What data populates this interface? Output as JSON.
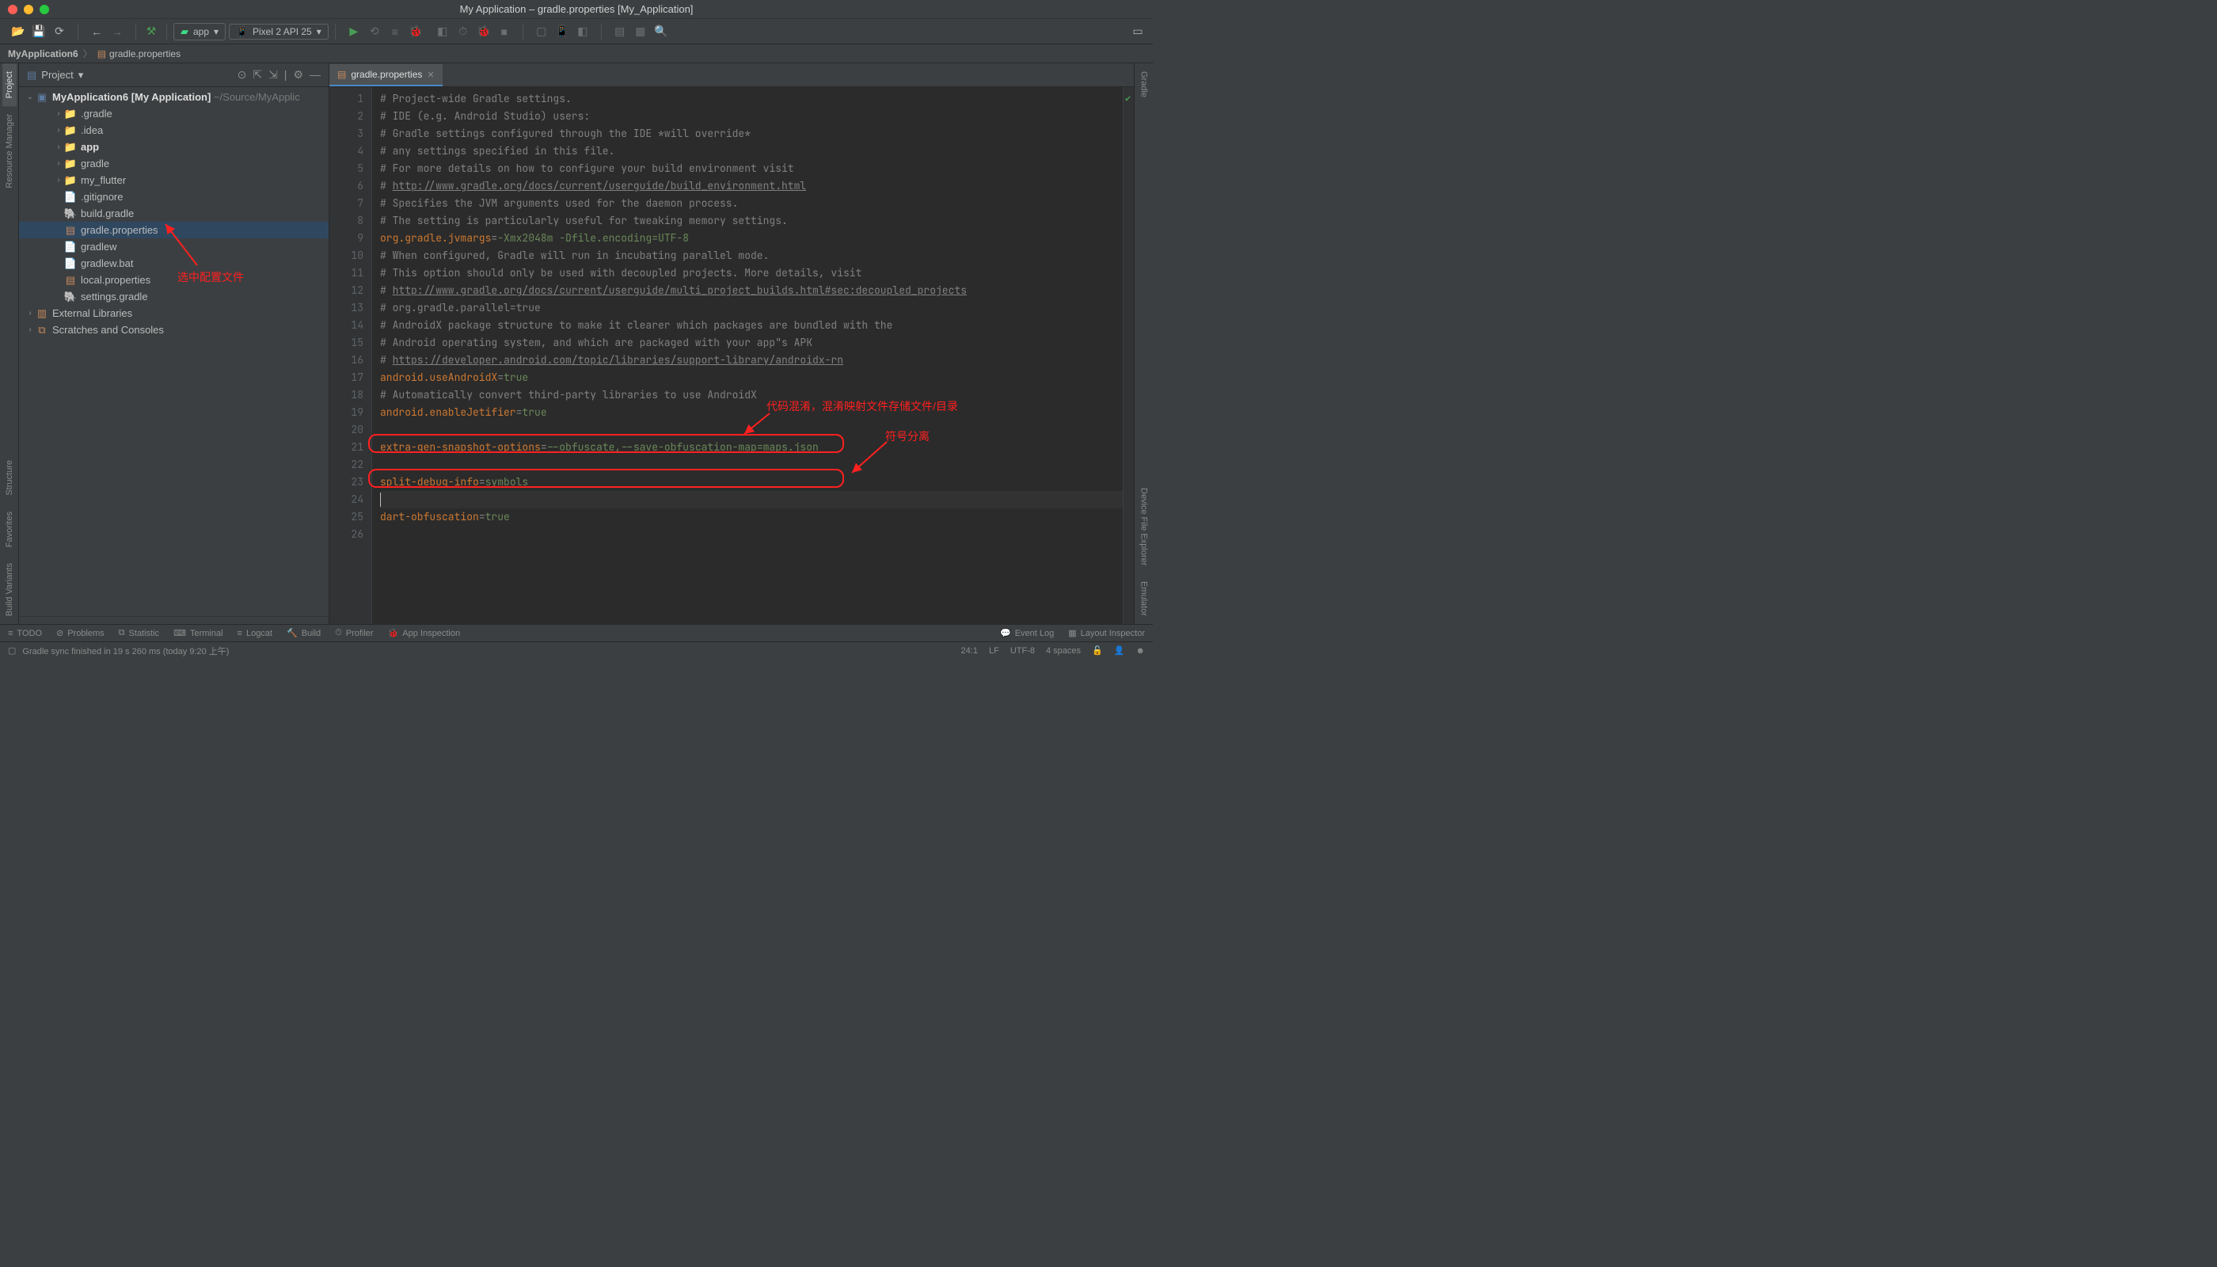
{
  "window": {
    "title": "My Application – gradle.properties [My_Application]"
  },
  "toolbar": {
    "config_app": "app",
    "device": "Pixel 2 API 25"
  },
  "breadcrumb": {
    "root": "MyApplication6",
    "file": "gradle.properties"
  },
  "projectPanel": {
    "title": "Project",
    "tree": {
      "root": {
        "name": "MyApplication6",
        "suffix": " [My Application]",
        "path": "~/Source/MyApplic"
      },
      "items": [
        {
          "name": ".gradle",
          "icon": "folder-orange",
          "indent": 1,
          "arrow": "›"
        },
        {
          "name": ".idea",
          "icon": "folder-grey",
          "indent": 1,
          "arrow": "›"
        },
        {
          "name": "app",
          "icon": "folder-blue",
          "indent": 1,
          "arrow": "›",
          "bold": true
        },
        {
          "name": "gradle",
          "icon": "folder-grey",
          "indent": 1,
          "arrow": "›"
        },
        {
          "name": "my_flutter",
          "icon": "folder-grey",
          "indent": 1,
          "arrow": "›"
        },
        {
          "name": ".gitignore",
          "icon": "file",
          "indent": 1
        },
        {
          "name": "build.gradle",
          "icon": "gradle",
          "indent": 1
        },
        {
          "name": "gradle.properties",
          "icon": "props",
          "indent": 1,
          "selected": true
        },
        {
          "name": "gradlew",
          "icon": "file-purple",
          "indent": 1
        },
        {
          "name": "gradlew.bat",
          "icon": "file",
          "indent": 1
        },
        {
          "name": "local.properties",
          "icon": "props",
          "indent": 1
        },
        {
          "name": "settings.gradle",
          "icon": "gradle",
          "indent": 1
        }
      ],
      "externals": "External Libraries",
      "scratches": "Scratches and Consoles"
    }
  },
  "editor": {
    "tab_label": "gradle.properties",
    "lines": [
      {
        "n": 1,
        "t": "comment",
        "text": "# Project-wide Gradle settings."
      },
      {
        "n": 2,
        "t": "comment",
        "text": "# IDE (e.g. Android Studio) users:"
      },
      {
        "n": 3,
        "t": "comment",
        "text": "# Gradle settings configured through the IDE *will override*"
      },
      {
        "n": 4,
        "t": "comment",
        "text": "# any settings specified in this file."
      },
      {
        "n": 5,
        "t": "comment",
        "text": "# For more details on how to configure your build environment visit"
      },
      {
        "n": 6,
        "t": "commentlink",
        "pre": "# ",
        "link": "http://www.gradle.org/docs/current/userguide/build_environment.html"
      },
      {
        "n": 7,
        "t": "comment",
        "text": "# Specifies the JVM arguments used for the daemon process."
      },
      {
        "n": 8,
        "t": "comment",
        "text": "# The setting is particularly useful for tweaking memory settings."
      },
      {
        "n": 9,
        "t": "kv",
        "key": "org.gradle.jvmargs",
        "val": "-Xmx2048m -Dfile.encoding=UTF-8"
      },
      {
        "n": 10,
        "t": "comment",
        "text": "# When configured, Gradle will run in incubating parallel mode."
      },
      {
        "n": 11,
        "t": "comment",
        "text": "# This option should only be used with decoupled projects. More details, visit"
      },
      {
        "n": 12,
        "t": "commentlink",
        "pre": "# ",
        "link": "http://www.gradle.org/docs/current/userguide/multi_project_builds.html#sec:decoupled_projects"
      },
      {
        "n": 13,
        "t": "comment",
        "text": "# org.gradle.parallel=true"
      },
      {
        "n": 14,
        "t": "comment",
        "text": "# AndroidX package structure to make it clearer which packages are bundled with the"
      },
      {
        "n": 15,
        "t": "comment",
        "text": "# Android operating system, and which are packaged with your app\"s APK"
      },
      {
        "n": 16,
        "t": "commentlink",
        "pre": "# ",
        "link": "https://developer.android.com/topic/libraries/support-library/androidx-rn"
      },
      {
        "n": 17,
        "t": "kv",
        "key": "android.useAndroidX",
        "val": "true"
      },
      {
        "n": 18,
        "t": "comment",
        "text": "# Automatically convert third-party libraries to use AndroidX"
      },
      {
        "n": 19,
        "t": "kv",
        "key": "android.enableJetifier",
        "val": "true"
      },
      {
        "n": 20,
        "t": "empty"
      },
      {
        "n": 21,
        "t": "kv",
        "key": "extra-gen-snapshot-options",
        "val": "--obfuscate,--save-obfuscation-map=maps.json"
      },
      {
        "n": 22,
        "t": "empty"
      },
      {
        "n": 23,
        "t": "kv",
        "key": "split-debug-info",
        "val": "symbols"
      },
      {
        "n": 24,
        "t": "caret"
      },
      {
        "n": 25,
        "t": "kv",
        "key": "dart-obfuscation",
        "val": "true"
      },
      {
        "n": 26,
        "t": "empty"
      }
    ]
  },
  "annotations": {
    "select_config": "选中配置文件",
    "obfuscate": "代码混淆，混淆映射文件存储文件/目录",
    "split": "符号分离"
  },
  "bottom": {
    "todo": "TODO",
    "problems": "Problems",
    "statistic": "Statistic",
    "terminal": "Terminal",
    "logcat": "Logcat",
    "build": "Build",
    "profiler": "Profiler",
    "inspection": "App Inspection",
    "eventlog": "Event Log",
    "layout": "Layout Inspector"
  },
  "status": {
    "message": "Gradle sync finished in 19 s 260 ms (today 9:20 上午)",
    "pos": "24:1",
    "le": "LF",
    "enc": "UTF-8",
    "indent": "4 spaces"
  },
  "leftStrip": {
    "project": "Project",
    "resource": "Resource Manager",
    "structure": "Structure",
    "favorites": "Favorites",
    "buildvar": "Build Variants"
  },
  "rightStrip": {
    "gradle": "Gradle",
    "device": "Device File Explorer",
    "emulator": "Emulator"
  }
}
